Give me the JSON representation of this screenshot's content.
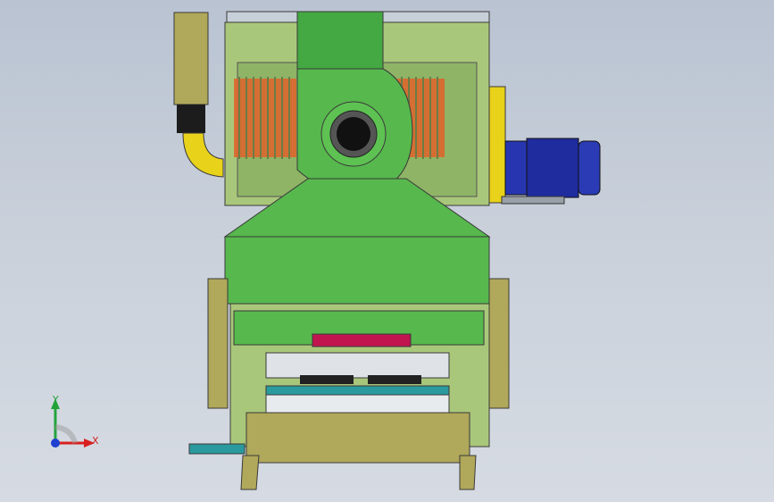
{
  "viewport": {
    "background_top": "#b9c3d2",
    "background_bottom": "#d6dbe3"
  },
  "colors": {
    "frame_green": "#a9c77a",
    "body_green": "#57b84d",
    "duct_green": "#44a843",
    "olive": "#b0a85a",
    "motor_blue": "#1f2c9e",
    "mount_yellow": "#e8d21a",
    "belt_red": "#c0154f",
    "roller_teal": "#2a9a9e",
    "coil_orange": "#e0622a"
  },
  "triad": {
    "y_label": "Y",
    "x_label": "X",
    "y_color": "#22a33a",
    "x_color": "#d81f1f",
    "z_color": "#1e3fd0"
  }
}
